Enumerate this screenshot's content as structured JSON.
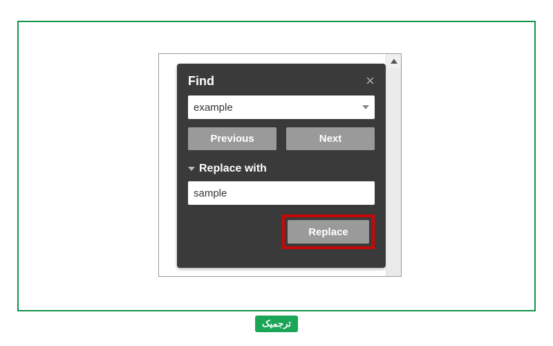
{
  "panel": {
    "title": "Find",
    "find_value": "example",
    "prev_label": "Previous",
    "next_label": "Next",
    "replace_section_label": "Replace with",
    "replace_value": "sample",
    "replace_button_label": "Replace"
  },
  "watermark": "ترجمیک"
}
